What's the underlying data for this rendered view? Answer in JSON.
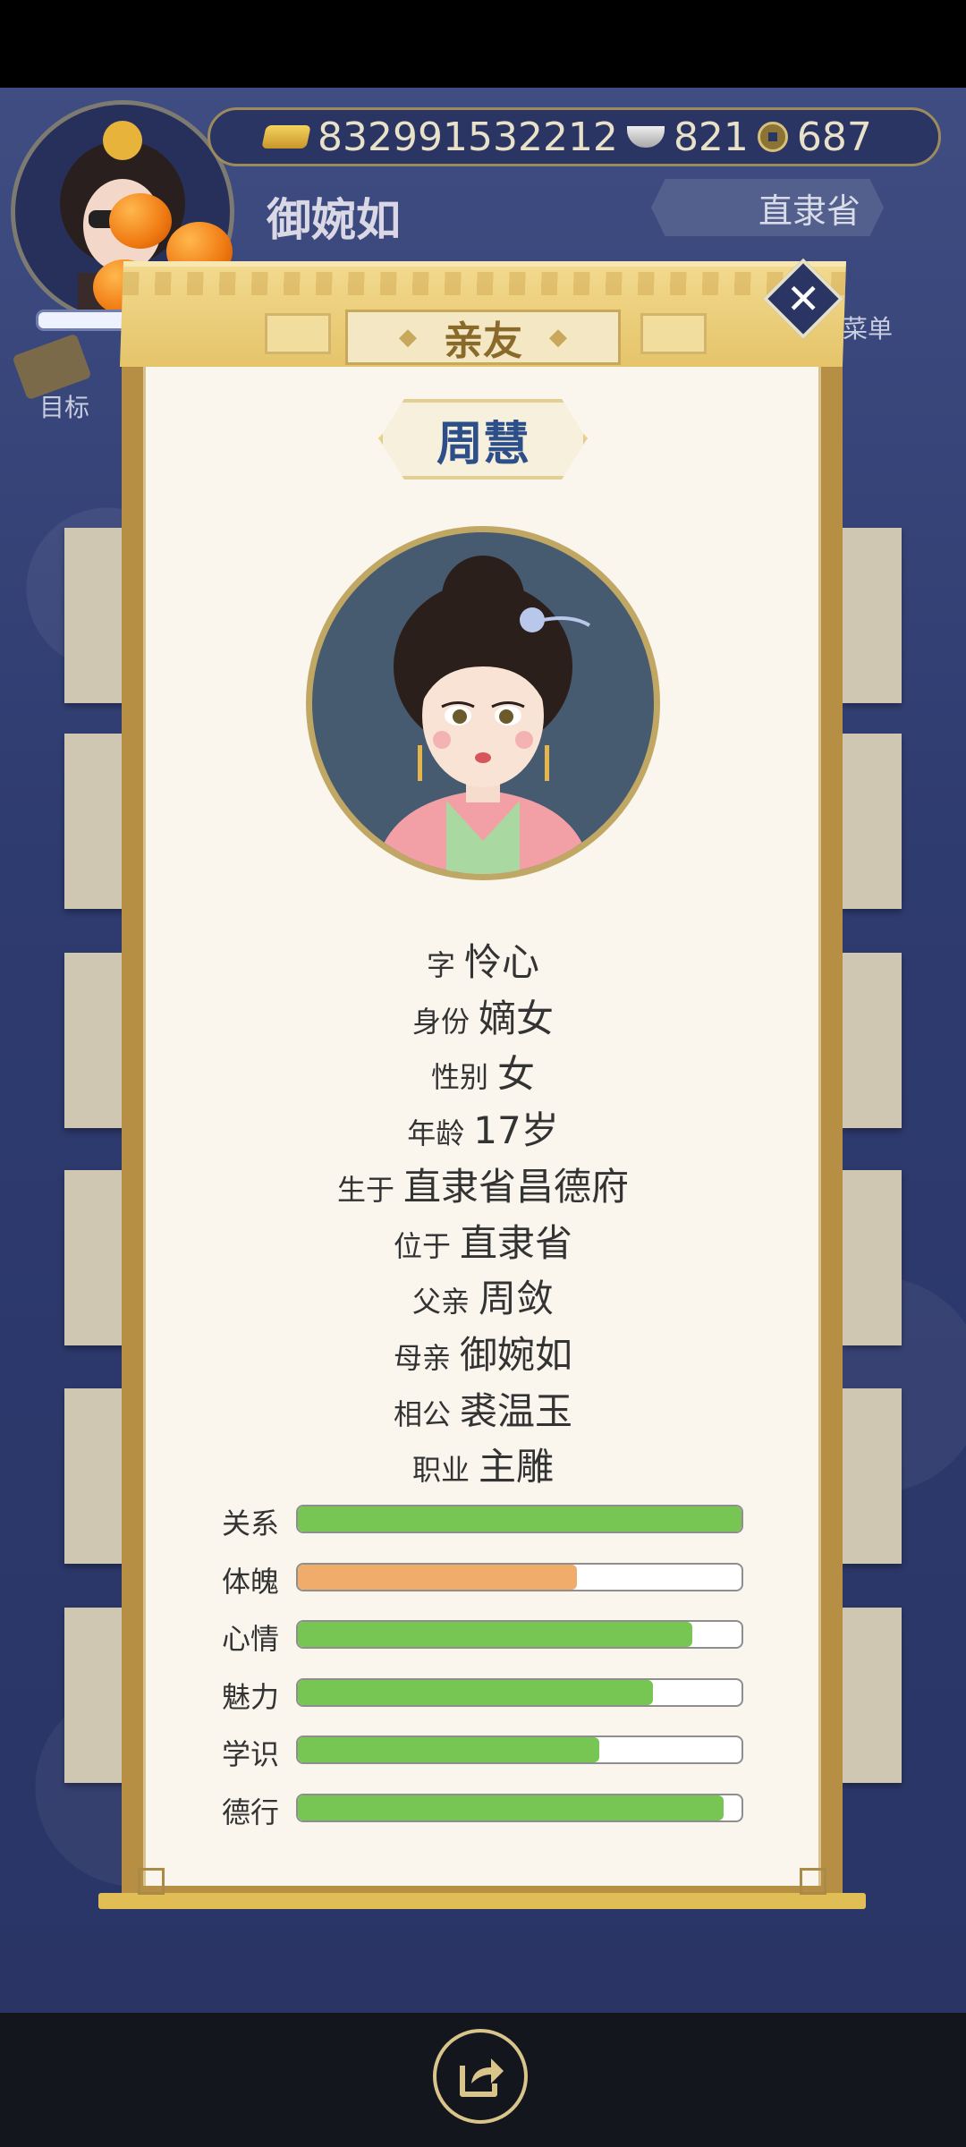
{
  "hud": {
    "gold": "832991532212",
    "silver": "821",
    "coins": "687",
    "player_name": "御婉如",
    "province_button": "直隶省",
    "menu_label": "菜单",
    "goal_label": "目标"
  },
  "dialog": {
    "title": "亲友",
    "name": "周慧",
    "info": [
      {
        "key": "字",
        "value": "怜心"
      },
      {
        "key": "身份",
        "value": "嫡女"
      },
      {
        "key": "性别",
        "value": "女"
      },
      {
        "key": "年龄",
        "value": "17岁"
      },
      {
        "key": "生于",
        "value": "直隶省昌德府"
      },
      {
        "key": "位于",
        "value": "直隶省"
      },
      {
        "key": "父亲",
        "value": "周敛"
      },
      {
        "key": "母亲",
        "value": "御婉如"
      },
      {
        "key": "相公",
        "value": "裘温玉"
      },
      {
        "key": "职业",
        "value": "主雕"
      }
    ],
    "stats": [
      {
        "label": "关系",
        "fraction": 1.0,
        "color": "#77c553"
      },
      {
        "label": "体魄",
        "fraction": 0.63,
        "color": "#f0ac6b"
      },
      {
        "label": "心情",
        "fraction": 0.89,
        "color": "#77c553"
      },
      {
        "label": "魅力",
        "fraction": 0.8,
        "color": "#77c553"
      },
      {
        "label": "学识",
        "fraction": 0.68,
        "color": "#77c553"
      },
      {
        "label": "德行",
        "fraction": 0.96,
        "color": "#77c553"
      }
    ]
  },
  "icons": {
    "close": "close-icon",
    "share": "share-icon"
  }
}
